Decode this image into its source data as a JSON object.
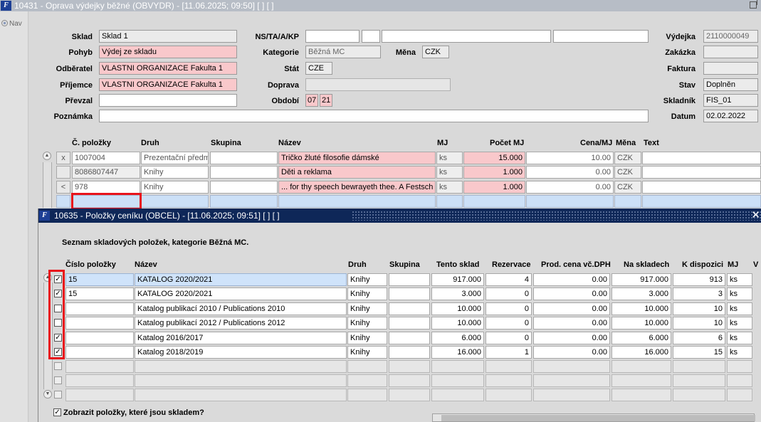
{
  "main_window": {
    "title": "10431 - Oprava výdejky běžné (OBVYDR) - [11.06.2025; 09:50]   [ ]   [ ]",
    "nav_label": "Nav",
    "colors": {
      "pink": "#f9c8cb",
      "titlebar": "#b7bdc6",
      "popup_titlebar": "#0e2758",
      "highlight": "#e8131b"
    }
  },
  "form": {
    "sklad": {
      "label": "Sklad",
      "value": "Sklad 1"
    },
    "pohyb": {
      "label": "Pohyb",
      "value": "Výdej ze skladu"
    },
    "odberatel": {
      "label": "Odběratel",
      "value": "VLASTNI ORGANIZACE Fakulta 1"
    },
    "prijemce": {
      "label": "Příjemce",
      "value": "VLASTNI ORGANIZACE Fakulta 1"
    },
    "prevzal": {
      "label": "Převzal",
      "value": ""
    },
    "poznamka": {
      "label": "Poznámka",
      "value": ""
    },
    "ns_ta": {
      "label": "NS/TA/A/KP",
      "values": [
        "",
        "",
        "",
        ""
      ]
    },
    "kategorie": {
      "label": "Kategorie",
      "value": "Běžná MC"
    },
    "mena": {
      "label": "Měna",
      "value": "CZK"
    },
    "stat": {
      "label": "Stát",
      "value": "CZE"
    },
    "doprava": {
      "label": "Doprava",
      "value": ""
    },
    "obdobi": {
      "label": "Období",
      "month": "07",
      "year": "21"
    },
    "vydejka": {
      "label": "Výdejka",
      "value": "2110000049"
    },
    "zakazka": {
      "label": "Zakázka",
      "value": ""
    },
    "faktura": {
      "label": "Faktura",
      "value": ""
    },
    "stav": {
      "label": "Stav",
      "value": "Doplněn"
    },
    "skladnik": {
      "label": "Skladník",
      "value": "FIS_01"
    },
    "datum": {
      "label": "Datum",
      "value": "02.02.2022"
    }
  },
  "items_table": {
    "headers": {
      "cislo": "Č. položky",
      "druh": "Druh",
      "skupina": "Skupina",
      "nazev": "Název",
      "mj": "MJ",
      "pocet": "Počet MJ",
      "cena": "Cena/MJ",
      "mena": "Měna",
      "text": "Text"
    },
    "rows": [
      {
        "ind": "x",
        "cislo": "1007004",
        "druh": "Prezentační předm",
        "skupina": "",
        "nazev": "Tričko žluté filosofie dámské",
        "mj": "ks",
        "pocet": "15.000",
        "cena": "10.00",
        "mena": "CZK",
        "text": ""
      },
      {
        "ind": "",
        "cislo": "8086807447",
        "druh": "Knihy",
        "skupina": "",
        "nazev": "Děti a reklama",
        "mj": "ks",
        "pocet": "1.000",
        "cena": "0.00",
        "mena": "CZK",
        "text": ""
      },
      {
        "ind": "<",
        "cislo": "978",
        "druh": "Knihy",
        "skupina": "",
        "nazev": "... for thy speech bewrayeth thee. A Festsch",
        "mj": "ks",
        "pocet": "1.000",
        "cena": "0.00",
        "mena": "CZK",
        "text": ""
      }
    ]
  },
  "popup": {
    "title": "10635 - Položky ceníku (OBCEL) - [11.06.2025; 09:51]   [ ]   [ ]",
    "section_title": "Seznam skladových položek, kategorie Běžná MC.",
    "headers": {
      "cislo": "Číslo položky",
      "nazev": "Název",
      "druh": "Druh",
      "skupina": "Skupina",
      "tento": "Tento sklad",
      "rezervace": "Rezervace",
      "prod": "Prod. cena vč.DPH",
      "naskladech": "Na skladech",
      "kdispozici": "K dispozici",
      "mj": "MJ",
      "v": "V"
    },
    "rows": [
      {
        "checked": true,
        "cislo": "15",
        "nazev": "KATALOG 2020/2021",
        "druh": "Knihy",
        "skupina": "",
        "tento": "917.000",
        "rezervace": "4",
        "prod": "0.00",
        "naskladech": "917.000",
        "kdispozici": "913",
        "mj": "ks"
      },
      {
        "checked": true,
        "cislo": "15",
        "nazev": "KATALOG 2020/2021",
        "druh": "Knihy",
        "skupina": "",
        "tento": "3.000",
        "rezervace": "0",
        "prod": "0.00",
        "naskladech": "3.000",
        "kdispozici": "3",
        "mj": "ks"
      },
      {
        "checked": false,
        "cislo": "",
        "nazev": "Katalog publikací 2010 / Publications 2010",
        "druh": "Knihy",
        "skupina": "",
        "tento": "10.000",
        "rezervace": "0",
        "prod": "0.00",
        "naskladech": "10.000",
        "kdispozici": "10",
        "mj": "ks"
      },
      {
        "checked": false,
        "cislo": "",
        "nazev": "Katalog publikací 2012 / Publications 2012",
        "druh": "Knihy",
        "skupina": "",
        "tento": "10.000",
        "rezervace": "0",
        "prod": "0.00",
        "naskladech": "10.000",
        "kdispozici": "10",
        "mj": "ks"
      },
      {
        "checked": true,
        "cislo": "",
        "nazev": "Katalog 2016/2017",
        "druh": "Knihy",
        "skupina": "",
        "tento": "6.000",
        "rezervace": "0",
        "prod": "0.00",
        "naskladech": "6.000",
        "kdispozici": "6",
        "mj": "ks"
      },
      {
        "checked": true,
        "cislo": "",
        "nazev": "Katalog 2018/2019",
        "druh": "Knihy",
        "skupina": "",
        "tento": "16.000",
        "rezervace": "1",
        "prod": "0.00",
        "naskladech": "16.000",
        "kdispozici": "15",
        "mj": "ks"
      }
    ],
    "empty_rows": 3,
    "footer_checkbox": {
      "checked": true,
      "label": "Zobrazit položky, které jsou skladem?"
    }
  }
}
